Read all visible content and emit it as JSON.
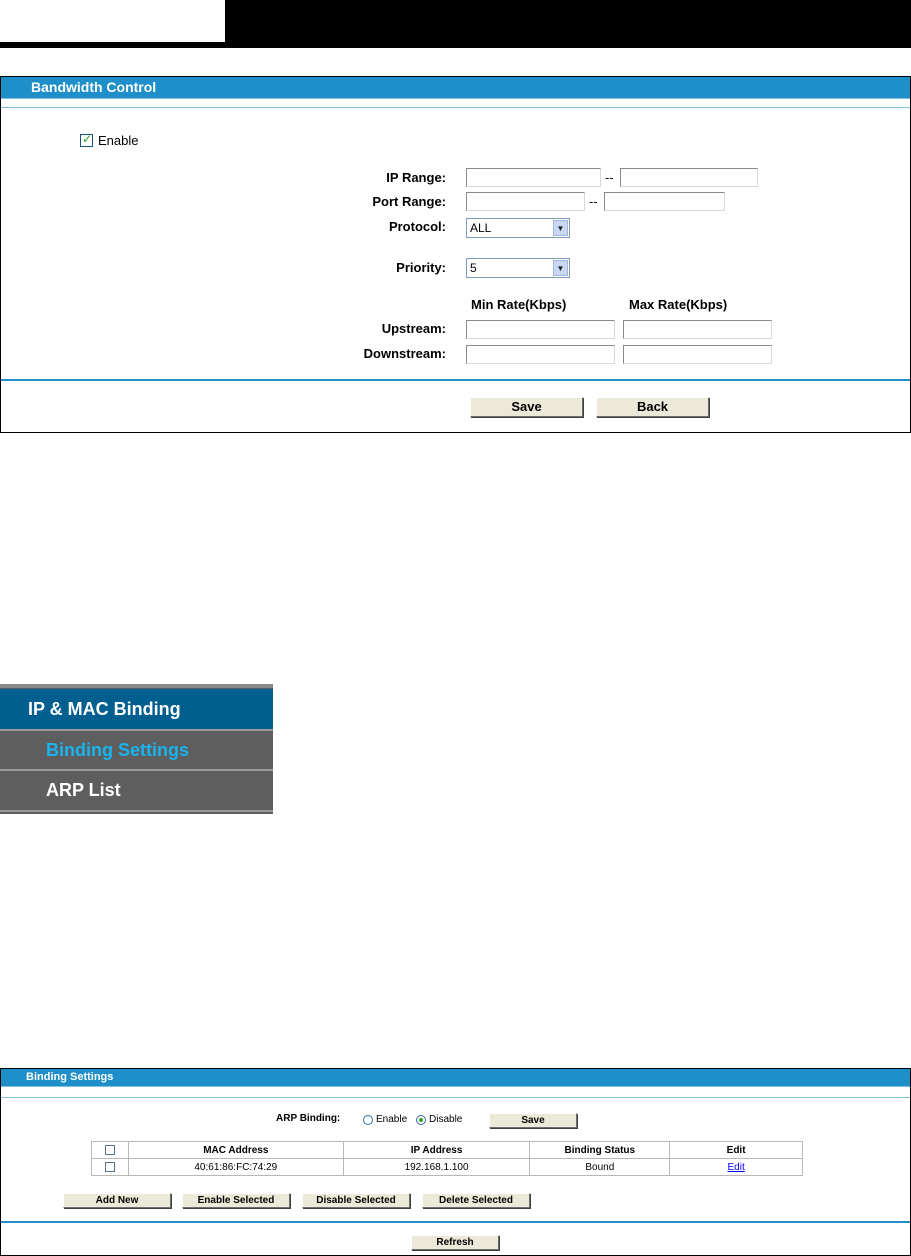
{
  "bandwidth": {
    "title": "Bandwidth Control",
    "enable_label": "Enable",
    "enable_checked": true,
    "ip_range_label": "IP Range:",
    "port_range_label": "Port Range:",
    "range_sep": "--",
    "protocol_label": "Protocol:",
    "protocol_value": "ALL",
    "priority_label": "Priority:",
    "priority_value": "5",
    "min_rate_header": "Min Rate(Kbps)",
    "max_rate_header": "Max Rate(Kbps)",
    "upstream_label": "Upstream:",
    "downstream_label": "Downstream:",
    "save_label": "Save",
    "back_label": "Back"
  },
  "menu": {
    "header": "IP & MAC Binding",
    "items": [
      {
        "label": "Binding Settings",
        "active": true
      },
      {
        "label": "ARP List",
        "active": false
      }
    ],
    "colors": {
      "active": "#19b4f0",
      "normal": "#ffffff"
    }
  },
  "binding": {
    "title": "Binding Settings",
    "arp_label": "ARP Binding:",
    "enable_label": "Enable",
    "disable_label": "Disable",
    "selected": "Disable",
    "save_label": "Save",
    "columns": [
      "MAC Address",
      "IP Address",
      "Binding Status",
      "Edit"
    ],
    "rows": [
      {
        "mac": "40:61:86:FC:74:29",
        "ip": "192.168.1.100",
        "status": "Bound",
        "edit": "Edit"
      }
    ],
    "add_new_label": "Add New",
    "enable_selected_label": "Enable Selected",
    "disable_selected_label": "Disable Selected",
    "delete_selected_label": "Delete Selected",
    "refresh_label": "Refresh"
  }
}
